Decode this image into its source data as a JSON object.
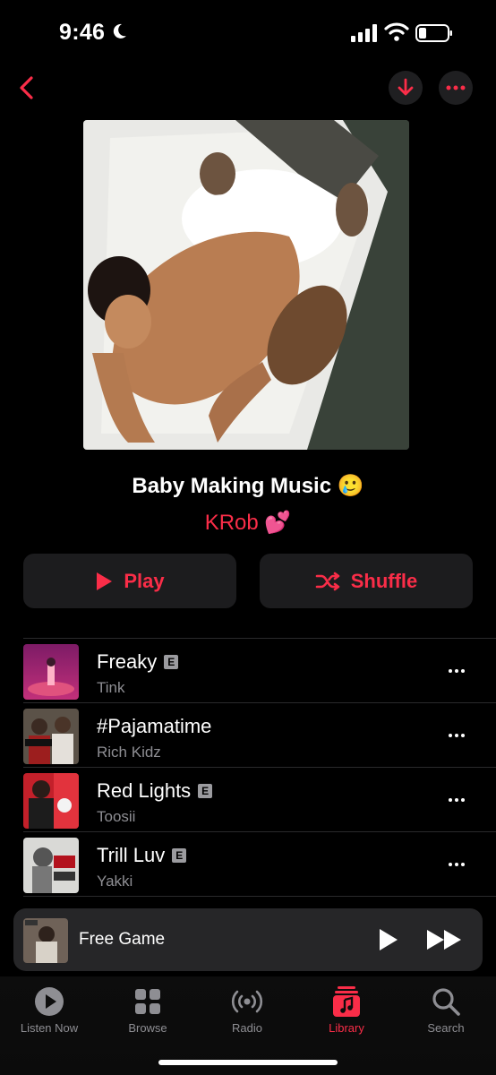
{
  "status_bar": {
    "time": "9:46"
  },
  "nav": {
    "back_icon": "chevron-left-icon",
    "download_icon": "download-icon",
    "more_icon": "ellipsis-icon"
  },
  "playlist": {
    "title": "Baby Making Music 🥲",
    "curator": "KRob 💕"
  },
  "actions": {
    "play_label": "Play",
    "shuffle_label": "Shuffle"
  },
  "tracks": [
    {
      "title": "Freaky",
      "artist": "Tink",
      "explicit": true
    },
    {
      "title": "#Pajamatime",
      "artist": "Rich Kidz",
      "explicit": false
    },
    {
      "title": "Red Lights",
      "artist": "Toosii",
      "explicit": true
    },
    {
      "title": "Trill Luv",
      "artist": "Yakki",
      "explicit": true
    }
  ],
  "explicit_badge": "E",
  "mini_player": {
    "title": "Free Game"
  },
  "tabs": [
    {
      "label": "Listen Now",
      "icon": "play-circle-icon",
      "active": false
    },
    {
      "label": "Browse",
      "icon": "grid-icon",
      "active": false
    },
    {
      "label": "Radio",
      "icon": "radio-waves-icon",
      "active": false
    },
    {
      "label": "Library",
      "icon": "music-library-icon",
      "active": true
    },
    {
      "label": "Search",
      "icon": "search-icon",
      "active": false
    }
  ],
  "colors": {
    "accent": "#fa2d48",
    "background": "#000000",
    "card": "#1c1c1e",
    "secondary_text": "#8e8e93"
  }
}
